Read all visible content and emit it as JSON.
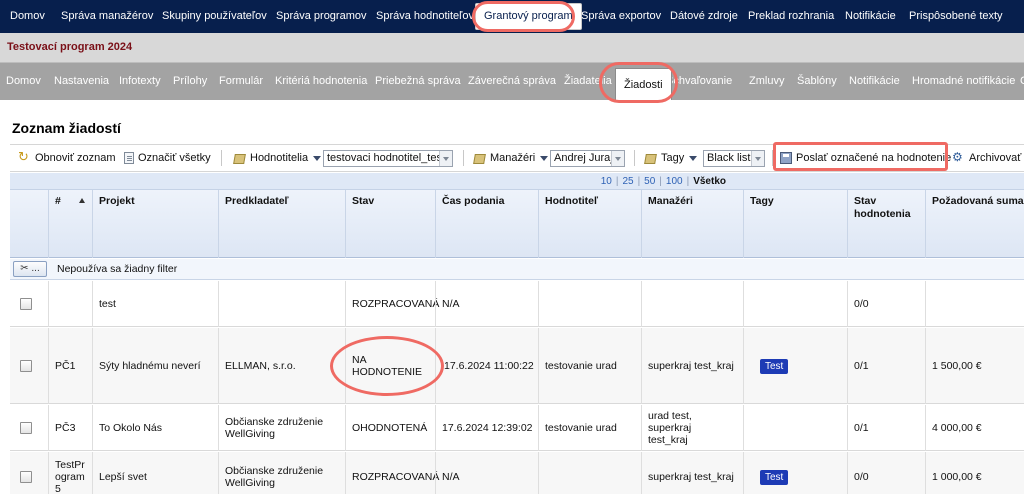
{
  "top_nav": [
    {
      "label": "Domov"
    },
    {
      "label": "Správa manažérov"
    },
    {
      "label": "Skupiny používateľov"
    },
    {
      "label": "Správa programov"
    },
    {
      "label": "Správa hodnotiteľov"
    },
    {
      "label": "Grantový program",
      "active": true
    },
    {
      "label": "Správa exportov"
    },
    {
      "label": "Dátové zdroje"
    },
    {
      "label": "Preklad rozhrania"
    },
    {
      "label": "Notifikácie"
    },
    {
      "label": "Prispôsobené texty"
    }
  ],
  "program_title": "Testovací program 2024",
  "sub_nav": [
    {
      "label": "Domov"
    },
    {
      "label": "Nastavenia"
    },
    {
      "label": "Infotexty"
    },
    {
      "label": "Prílohy"
    },
    {
      "label": "Formulár"
    },
    {
      "label": "Kritériá hodnotenia"
    },
    {
      "label": "Priebežná správa"
    },
    {
      "label": "Záverečná správa"
    },
    {
      "label": "Žiadatelia"
    },
    {
      "label": "Žiadosti",
      "active": true
    },
    {
      "label": "Schvaľovanie"
    },
    {
      "label": "Zmluvy"
    },
    {
      "label": "Šablóny"
    },
    {
      "label": "Notifikácie"
    },
    {
      "label": "Hromadné notifikácie"
    },
    {
      "label": "C"
    }
  ],
  "page_title": "Zoznam žiadostí",
  "toolbar": {
    "refresh_label": "Obnoviť zoznam",
    "select_all_label": "Označiť všetky",
    "evaluators_label": "Hodnotitelia",
    "evaluators_value": "testovaci hodnotitel_test",
    "managers_label": "Manažéri",
    "managers_value": "Andrej Juraj",
    "tags_label": "Tagy",
    "tags_value": "Black list",
    "send_label": "Poslať označené na hodnotenie",
    "archive_label": "Archivovať"
  },
  "pager": {
    "options": [
      "10",
      "25",
      "50",
      "100"
    ],
    "current": "Všetko"
  },
  "columns": [
    "#",
    "Projekt",
    "Predkladateľ",
    "Stav",
    "Čas podania",
    "Hodnotiteľ",
    "Manažéri",
    "Tagy",
    "Stav hodnotenia",
    "Požadovaná suma"
  ],
  "filter": {
    "button_label": "✂ ...",
    "text": "Nepoužíva sa žiadny filter"
  },
  "rows": [
    {
      "num": "",
      "project": "test",
      "applicant": "",
      "status": "ROZPRACOVANÁ",
      "submitted": "N/A",
      "evaluator": "",
      "managers": "",
      "tag": "",
      "eval_status": "0/0",
      "amount": ""
    },
    {
      "num": "PČ1",
      "project": "Sýty hladnému neverí",
      "applicant": "ELLMAN, s.r.o.",
      "status": "NA HODNOTENIE",
      "submitted": "17.6.2024 11:00:22",
      "evaluator": "testovanie urad",
      "managers": "superkraj test_kraj",
      "tag": "Test",
      "eval_status": "0/1",
      "amount": "1 500,00 €"
    },
    {
      "num": "PČ3",
      "project": "To Okolo Nás",
      "applicant": "Občianske združenie WellGiving",
      "status": "OHODNOTENÁ",
      "submitted": "17.6.2024 12:39:02",
      "evaluator": "testovanie urad",
      "managers": "urad test, superkraj test_kraj",
      "tag": "",
      "eval_status": "0/1",
      "amount": "4 000,00 €"
    },
    {
      "num": "TestProgram 5",
      "project": "Lepší svet",
      "applicant": "Občianske združenie WellGiving",
      "status": "ROZPRACOVANÁ",
      "submitted": "N/A",
      "evaluator": "",
      "managers": "superkraj test_kraj",
      "tag": "Test",
      "eval_status": "0/0",
      "amount": "1 000,00 €"
    }
  ],
  "colors": {
    "top_nav_bg": "#071f4d",
    "subnav_bg": "#a3a3a3",
    "program_title": "#7a1018",
    "highlight": "#ef6a63",
    "tag_bg": "#1d3bb5"
  }
}
